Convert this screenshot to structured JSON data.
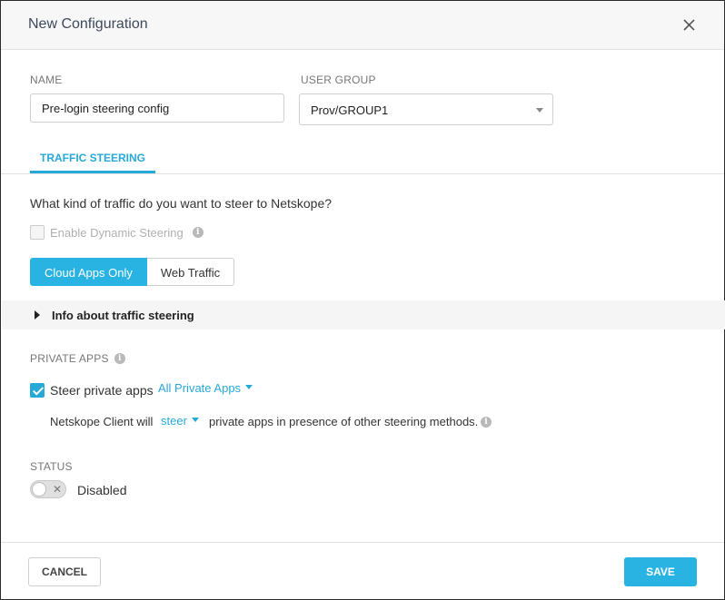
{
  "dialog": {
    "title": "New Configuration",
    "close_icon": "close-icon"
  },
  "form": {
    "name_label": "NAME",
    "name_value": "Pre-login steering config",
    "user_group_label": "USER GROUP",
    "user_group_value": "Prov/GROUP1"
  },
  "tabs": [
    {
      "label": "TRAFFIC STEERING",
      "active": true
    }
  ],
  "traffic": {
    "question": "What kind of traffic do you want to steer to Netskope?",
    "dynamic_steering_label": "Enable Dynamic Steering",
    "dynamic_steering_checked": false,
    "dynamic_steering_disabled": true,
    "segments": [
      {
        "label": "Cloud Apps Only",
        "active": true
      },
      {
        "label": "Web Traffic",
        "active": false
      }
    ],
    "info_toggle_label": "Info about traffic steering"
  },
  "private_apps": {
    "section_label": "PRIVATE APPS",
    "steer_label": "Steer private apps",
    "steer_checked": true,
    "apps_dropdown_value": "All Private Apps",
    "client_prefix": "Netskope Client will",
    "action_dropdown_value": "steer",
    "client_suffix": "private apps in presence of other steering methods."
  },
  "status": {
    "section_label": "STATUS",
    "toggle_on": false,
    "toggle_label": "Disabled"
  },
  "footer": {
    "cancel_label": "CANCEL",
    "save_label": "SAVE"
  },
  "colors": {
    "accent": "#29b3e3",
    "link": "#27a9d8",
    "header_bg": "#f7f7f7"
  }
}
